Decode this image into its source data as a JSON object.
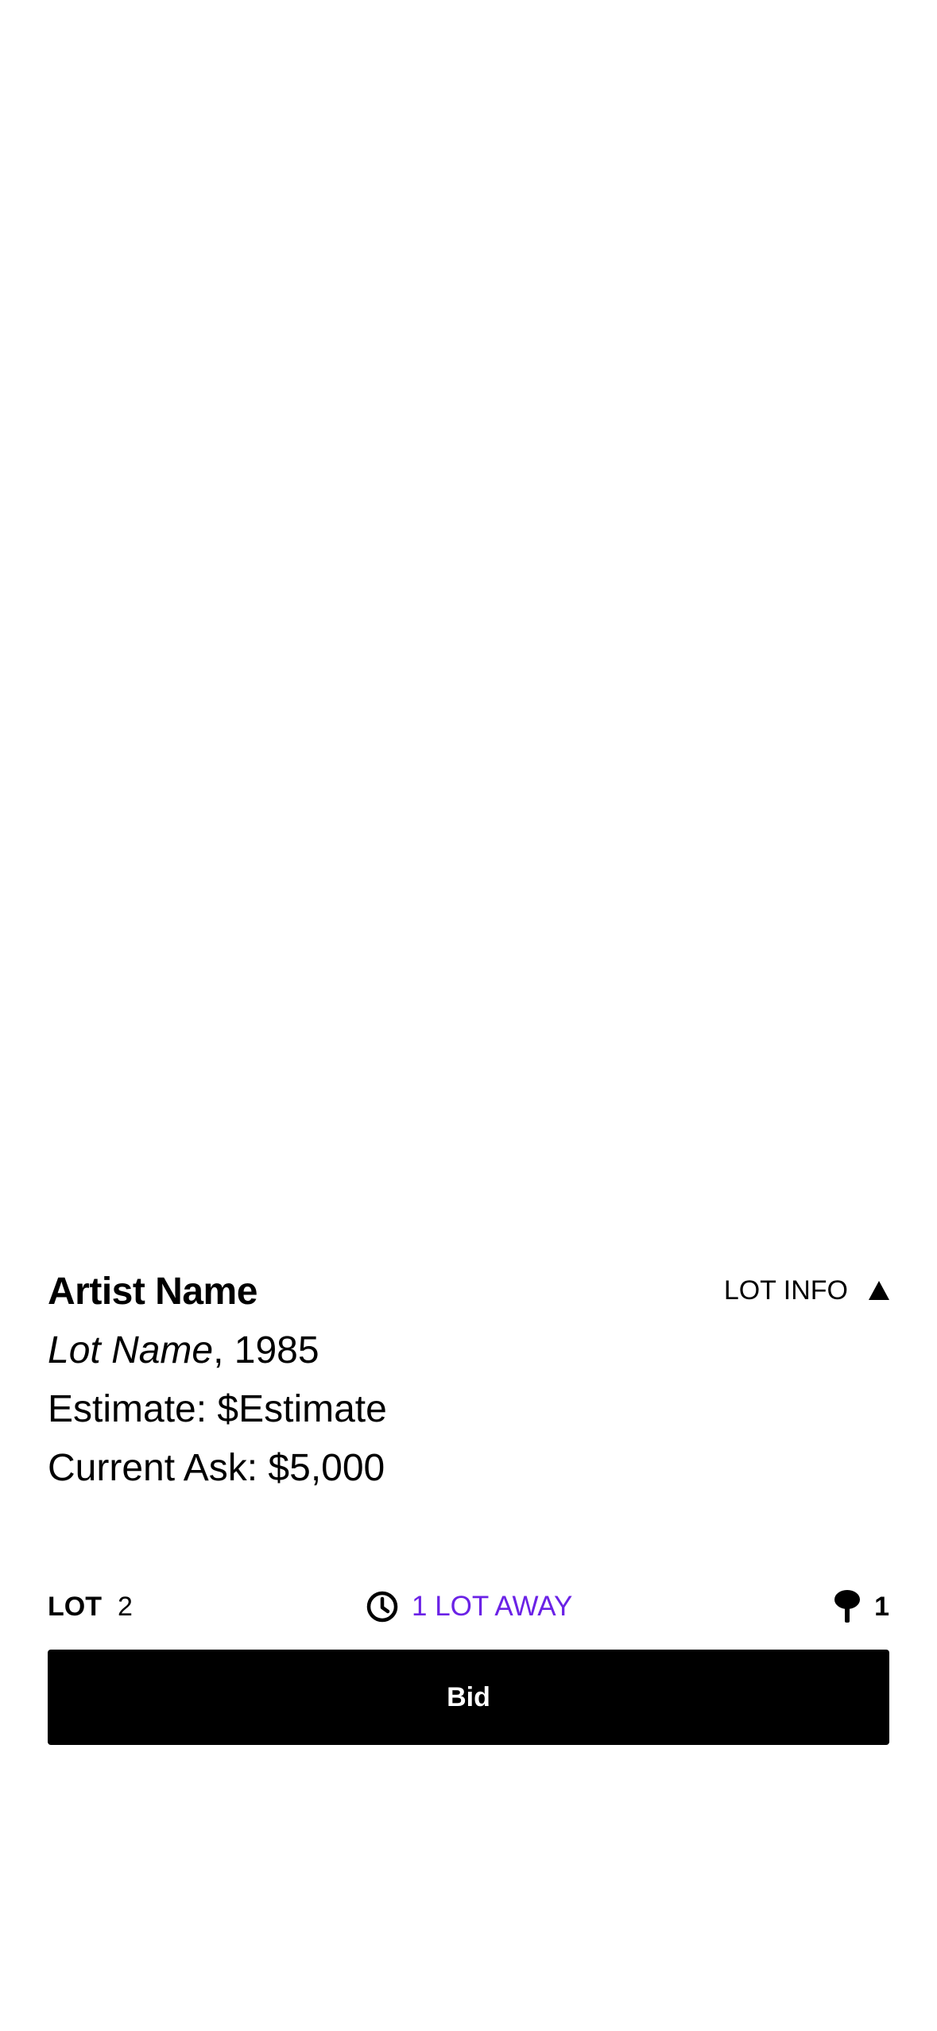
{
  "lot": {
    "artist_name": "Artist Name",
    "lot_name": "Lot Name",
    "year_suffix": ", 1985",
    "estimate": "Estimate: $Estimate",
    "current_ask": "Current Ask: $5,000"
  },
  "lot_info_toggle": {
    "label": "LOT INFO",
    "icon": "triangle-up-icon"
  },
  "status": {
    "lot_label": "LOT",
    "lot_number": "2",
    "lots_away_text": "1 LOT AWAY",
    "lots_away_icon": "clock-icon",
    "lots_away_color": "#6B22E6",
    "paddle_icon": "paddle-icon",
    "paddle_count": "1"
  },
  "bid_button": {
    "label": "Bid",
    "background": "#000000",
    "text_color": "#FFFFFF"
  }
}
